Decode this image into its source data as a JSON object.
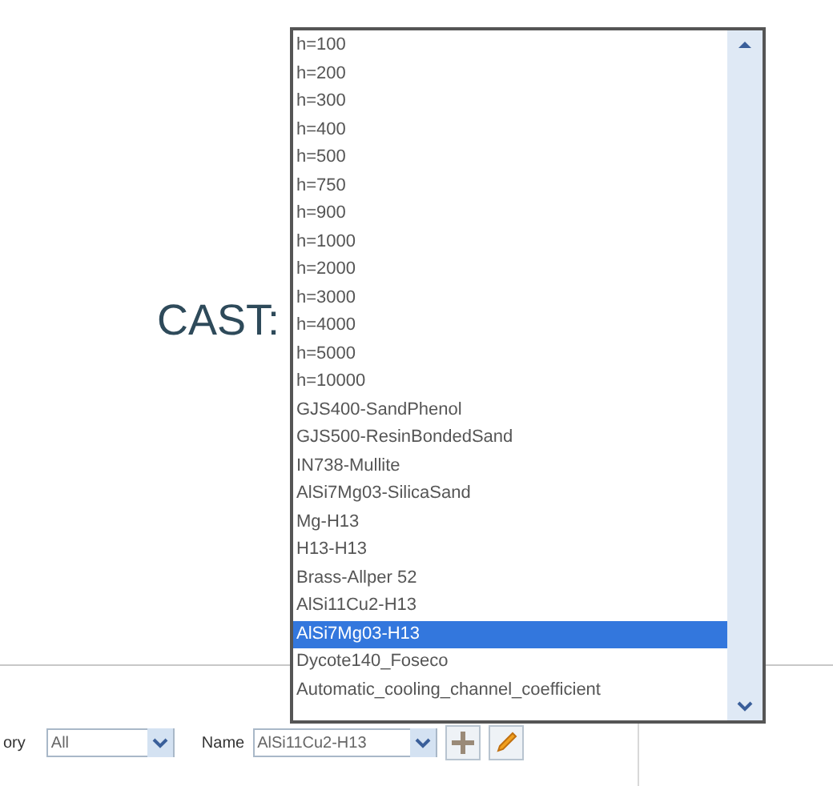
{
  "heading": "CAST:",
  "toolbar": {
    "category_label": "ory",
    "category_value": "All",
    "name_label": "Name",
    "name_value": "AlSi11Cu2-H13"
  },
  "dropdown_list": {
    "items": [
      {
        "label": "h=100",
        "selected": false
      },
      {
        "label": "h=200",
        "selected": false
      },
      {
        "label": "h=300",
        "selected": false
      },
      {
        "label": "h=400",
        "selected": false
      },
      {
        "label": "h=500",
        "selected": false
      },
      {
        "label": "h=750",
        "selected": false
      },
      {
        "label": "h=900",
        "selected": false
      },
      {
        "label": "h=1000",
        "selected": false
      },
      {
        "label": "h=2000",
        "selected": false
      },
      {
        "label": "h=3000",
        "selected": false
      },
      {
        "label": "h=4000",
        "selected": false
      },
      {
        "label": "h=5000",
        "selected": false
      },
      {
        "label": "h=10000",
        "selected": false
      },
      {
        "label": "GJS400-SandPhenol",
        "selected": false
      },
      {
        "label": "GJS500-ResinBondedSand",
        "selected": false
      },
      {
        "label": "IN738-Mullite",
        "selected": false
      },
      {
        "label": "AlSi7Mg03-SilicaSand",
        "selected": false
      },
      {
        "label": "Mg-H13",
        "selected": false
      },
      {
        "label": "H13-H13",
        "selected": false
      },
      {
        "label": "Brass-Allper 52",
        "selected": false
      },
      {
        "label": "AlSi11Cu2-H13",
        "selected": false
      },
      {
        "label": "AlSi7Mg03-H13",
        "selected": true
      },
      {
        "label": "Dycote140_Foseco",
        "selected": false
      },
      {
        "label": "Automatic_cooling_channel_coefficient",
        "selected": false
      }
    ]
  }
}
